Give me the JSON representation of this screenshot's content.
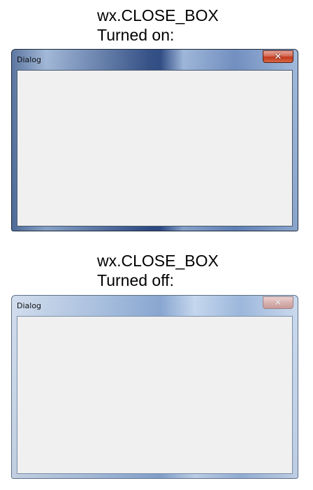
{
  "examples": [
    {
      "caption_line1": "wx.CLOSE_BOX",
      "caption_line2": "Turned on:",
      "window_title": "Dialog",
      "close_glyph": "✕",
      "close_button_visible": true,
      "window_state": "active"
    },
    {
      "caption_line1": "wx.CLOSE_BOX",
      "caption_line2": "Turned off:",
      "window_title": "Dialog",
      "close_glyph": "✕",
      "close_button_visible": true,
      "window_state": "inactive"
    }
  ],
  "colors": {
    "client_background": "#f0f0f0",
    "close_active": "#c2371c",
    "close_inactive": "#d7b2b0",
    "frame_active": "#1e3c78",
    "frame_inactive": "#aebfd6"
  }
}
